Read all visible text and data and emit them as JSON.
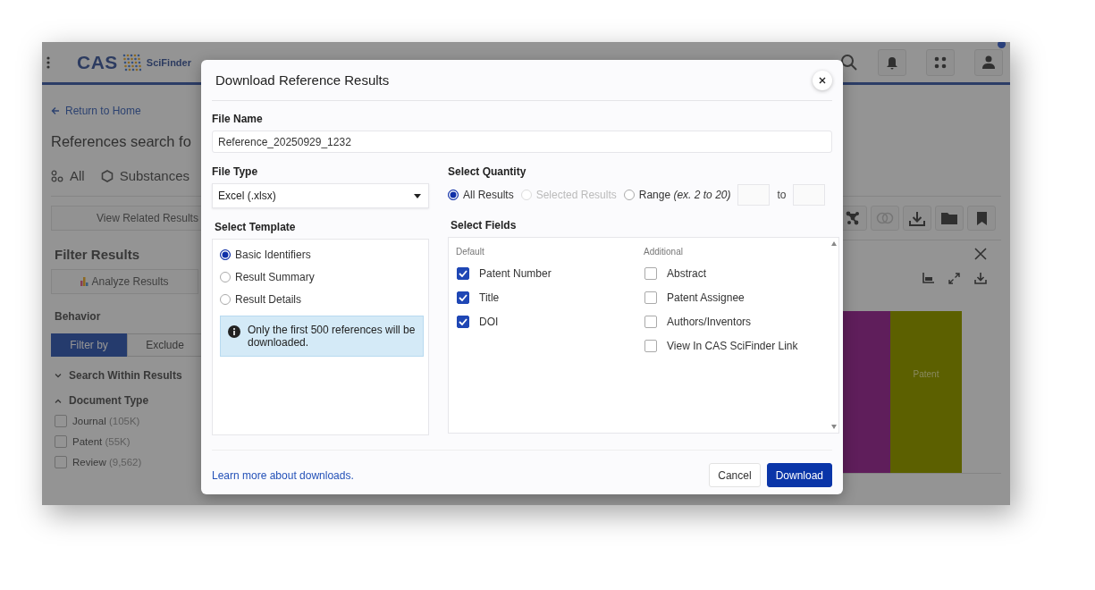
{
  "app": {
    "header": {
      "logo": "CAS",
      "product": "SciFinder",
      "has_notification": true
    },
    "back_link": "Return to Home",
    "page_title": "References search fo",
    "tabs": [
      {
        "label": "All",
        "kind": "all"
      },
      {
        "label": "Substances",
        "kind": "substances"
      }
    ],
    "related_button": "View Related Results",
    "toolbar": [
      {
        "kind": "network",
        "disabled": false
      },
      {
        "kind": "rings",
        "disabled": true
      },
      {
        "kind": "download",
        "disabled": false
      },
      {
        "kind": "folder",
        "disabled": false
      },
      {
        "kind": "bookmark",
        "disabled": false
      }
    ],
    "filter_panel": {
      "title": "Filter Results",
      "analyze_button": "Analyze Results",
      "behavior_label": "Behavior",
      "behavior_options": [
        {
          "label": "Filter by",
          "selected": true
        },
        {
          "label": "Exclude",
          "selected": false
        }
      ],
      "sections": [
        {
          "title": "Search Within Results",
          "expanded": false
        },
        {
          "title": "Document Type",
          "expanded": true
        }
      ],
      "document_types": [
        {
          "label": "Journal",
          "count": "(105K)",
          "checked": false
        },
        {
          "label": "Patent",
          "count": "(55K)",
          "checked": false
        },
        {
          "label": "Review",
          "count": "(9,562)",
          "checked": false
        }
      ]
    },
    "chart_panel": {
      "bars": [
        {
          "color": "#5f1e5b"
        },
        {
          "color": "#5c6000",
          "label": "Patent"
        }
      ]
    }
  },
  "dialog": {
    "title": "Download Reference Results",
    "file_name": {
      "label": "File Name",
      "value": "Reference_20250929_1232"
    },
    "file_type": {
      "label": "File Type",
      "value": "Excel (.xlsx)"
    },
    "quantity": {
      "label": "Select Quantity",
      "options": [
        {
          "label": "All Results",
          "selected": true,
          "disabled": false
        },
        {
          "label": "Selected Results",
          "selected": false,
          "disabled": true
        },
        {
          "label": "Range *(ex. 2 to 20)*",
          "selected": false,
          "disabled": false
        }
      ],
      "range_separator": "to"
    },
    "template": {
      "label": "Select Template",
      "options": [
        {
          "label": "Basic Identifiers",
          "selected": true
        },
        {
          "label": "Result Summary",
          "selected": false
        },
        {
          "label": "Result Details",
          "selected": false
        }
      ],
      "info": "Only the first 500 references will be downloaded."
    },
    "fields": {
      "label": "Select Fields",
      "groups": [
        {
          "title": "Default",
          "items": [
            {
              "label": "Patent Number",
              "checked": true
            },
            {
              "label": "Title",
              "checked": true
            },
            {
              "label": "DOI",
              "checked": true
            }
          ]
        },
        {
          "title": "Additional",
          "items": [
            {
              "label": "Abstract",
              "checked": false
            },
            {
              "label": "Patent Assignee",
              "checked": false
            },
            {
              "label": "Authors/Inventors",
              "checked": false
            },
            {
              "label": "View In CAS SciFinder Link",
              "checked": false
            }
          ]
        }
      ]
    },
    "help_link": "Learn more about downloads.",
    "buttons": [
      {
        "label": "Cancel",
        "kind": "secondary"
      },
      {
        "label": "Download",
        "kind": "primary"
      }
    ]
  }
}
